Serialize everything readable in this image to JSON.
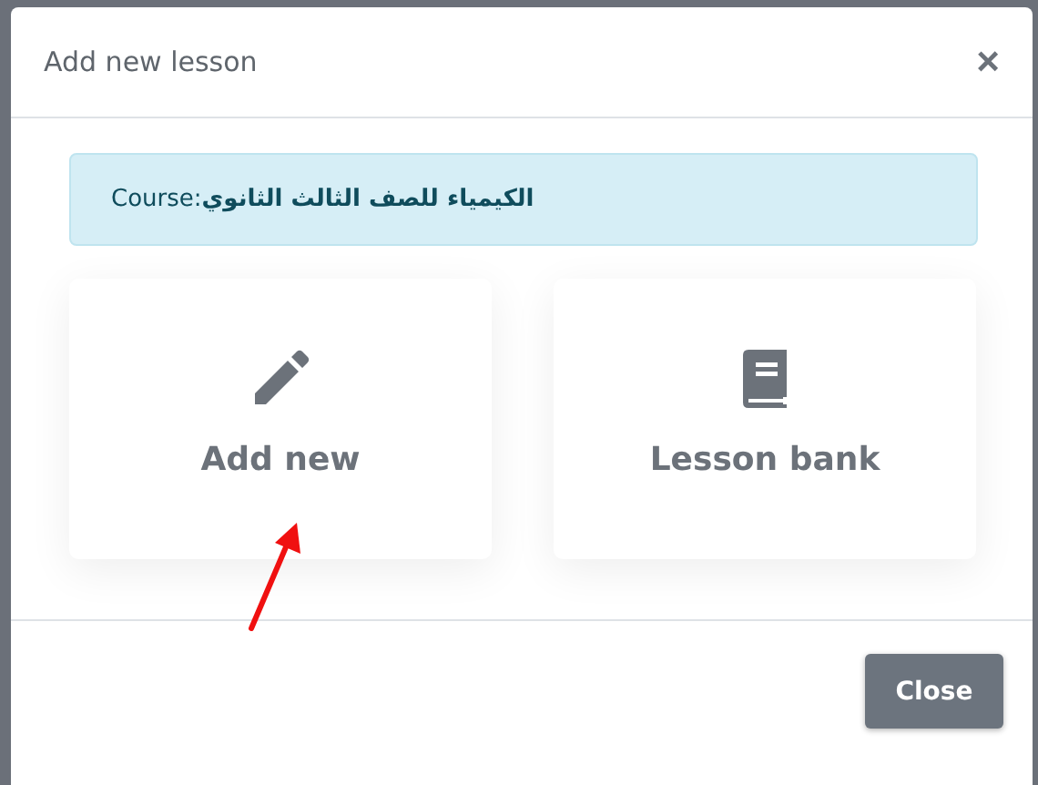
{
  "dialog": {
    "title": "Add new lesson",
    "close_symbol": "×",
    "course_info": "Course: **الكيمياء للصف الثالث الثانوي**",
    "options": [
      {
        "kind": "pencil",
        "label": "Add new"
      },
      {
        "kind": "book",
        "label": "Lesson bank"
      }
    ],
    "buttons": [
      "Close"
    ]
  }
}
